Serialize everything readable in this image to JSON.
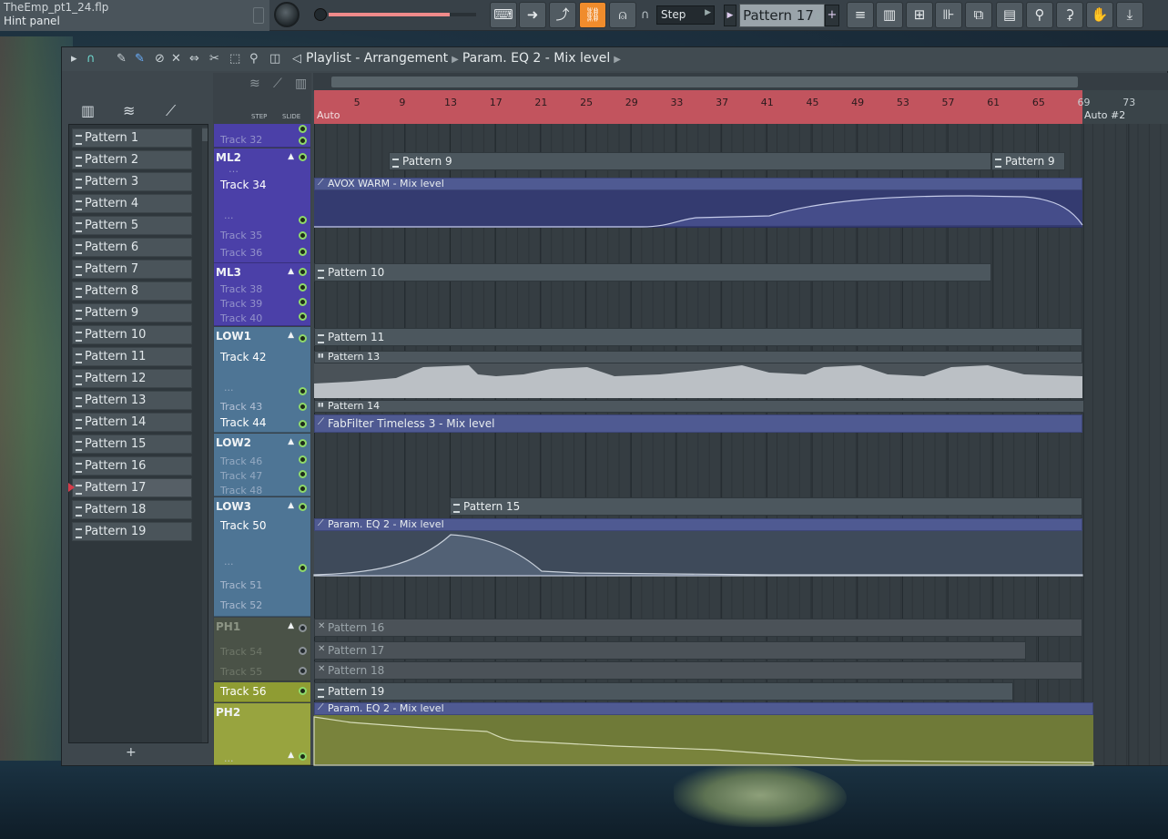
{
  "window": {
    "title": "TheEmp_pt1_24.flp",
    "hint": "Hint panel"
  },
  "toolbar": {
    "snap": "Step",
    "pattern": "Pattern 17",
    "master_volume_level": 0.82,
    "buttons": [
      "piano-keys-icon",
      "arrow-right-icon",
      "brush-icon",
      "link-icon",
      "bell-icon",
      "playlist-icon",
      "piano-roll-icon",
      "channel-rack-icon",
      "mixer-icon",
      "browser-icon",
      "file-icon",
      "plugin-icon",
      "tempo-icon",
      "hand-icon",
      "download-icon"
    ],
    "chars": [
      "⌨",
      "➜",
      "⤴",
      "⛓",
      "⍝",
      "≡",
      "▥",
      "⊞",
      "⊪",
      "⧉",
      "▤",
      "⚲",
      "⚳",
      "✋",
      "⤓"
    ]
  },
  "playlist": {
    "breadcrumb": [
      "Playlist - Arrangement",
      "Param. EQ 2 - Mix level"
    ],
    "picker_tabs": [
      "pattern-tab-icon",
      "audio-tab-icon",
      "automation-tab-icon"
    ],
    "picker_tab_chars": [
      "▥",
      "≋",
      "⟋"
    ],
    "header_strip": {
      "step": "STEP",
      "slide": "SLIDE"
    }
  },
  "patterns": [
    "Pattern 1",
    "Pattern 2",
    "Pattern 3",
    "Pattern 4",
    "Pattern 5",
    "Pattern 6",
    "Pattern 7",
    "Pattern 8",
    "Pattern 9",
    "Pattern 10",
    "Pattern 11",
    "Pattern 12",
    "Pattern 13",
    "Pattern 14",
    "Pattern 15",
    "Pattern 16",
    "Pattern 17",
    "Pattern 18",
    "Pattern 19"
  ],
  "current_pattern_index": 16,
  "ruler": {
    "bars": [
      "5",
      "9",
      "13",
      "17",
      "21",
      "25",
      "29",
      "33",
      "37",
      "41",
      "45",
      "49",
      "53",
      "57",
      "61",
      "65",
      "69",
      "73"
    ],
    "marker": "Auto",
    "marker2": "Auto #2"
  },
  "tracks": {
    "top_partial": [
      "Track 32"
    ],
    "ml2": {
      "name": "ML2",
      "sub": [
        "Track 34",
        "...",
        "Track 35",
        "Track 36"
      ]
    },
    "ml3": {
      "name": "ML3",
      "sub": [
        "Track 38",
        "Track 39",
        "Track 40"
      ]
    },
    "low1": {
      "name": "LOW1",
      "sub": [
        "Track 42",
        "...",
        "Track 43",
        "Track 44"
      ]
    },
    "low2": {
      "name": "LOW2",
      "sub": [
        "Track 46",
        "Track 47",
        "Track 48"
      ]
    },
    "low3": {
      "name": "LOW3",
      "sub": [
        "Track 50",
        "...",
        "Track 51",
        "Track 52"
      ]
    },
    "ph1": {
      "name": "PH1",
      "sub": [
        "Track 54",
        "Track 55",
        "Track 56"
      ]
    },
    "ph2": {
      "name": "PH2",
      "sub": [
        "..."
      ]
    }
  },
  "clips": {
    "pattern9": "Pattern 9",
    "avox": "AVOX WARM - Mix level",
    "pattern10": "Pattern 10",
    "pattern11": "Pattern 11",
    "pattern13": "Pattern 13",
    "pattern14": "Pattern 14",
    "fabfilter": "FabFilter Timeless 3 - Mix level",
    "pattern15": "Pattern 15",
    "eq2": "Param. EQ 2 - Mix level",
    "pattern16": "Pattern 16",
    "pattern17": "Pattern 17",
    "pattern18": "Pattern 18",
    "pattern19": "Pattern 19"
  },
  "colors": {
    "ml": "#4b40a8",
    "low": "#4e7595",
    "ph1": "#4a5247",
    "ph2": "#98a43f",
    "ruler": "#c2545e",
    "accent": "#f08c2c"
  }
}
